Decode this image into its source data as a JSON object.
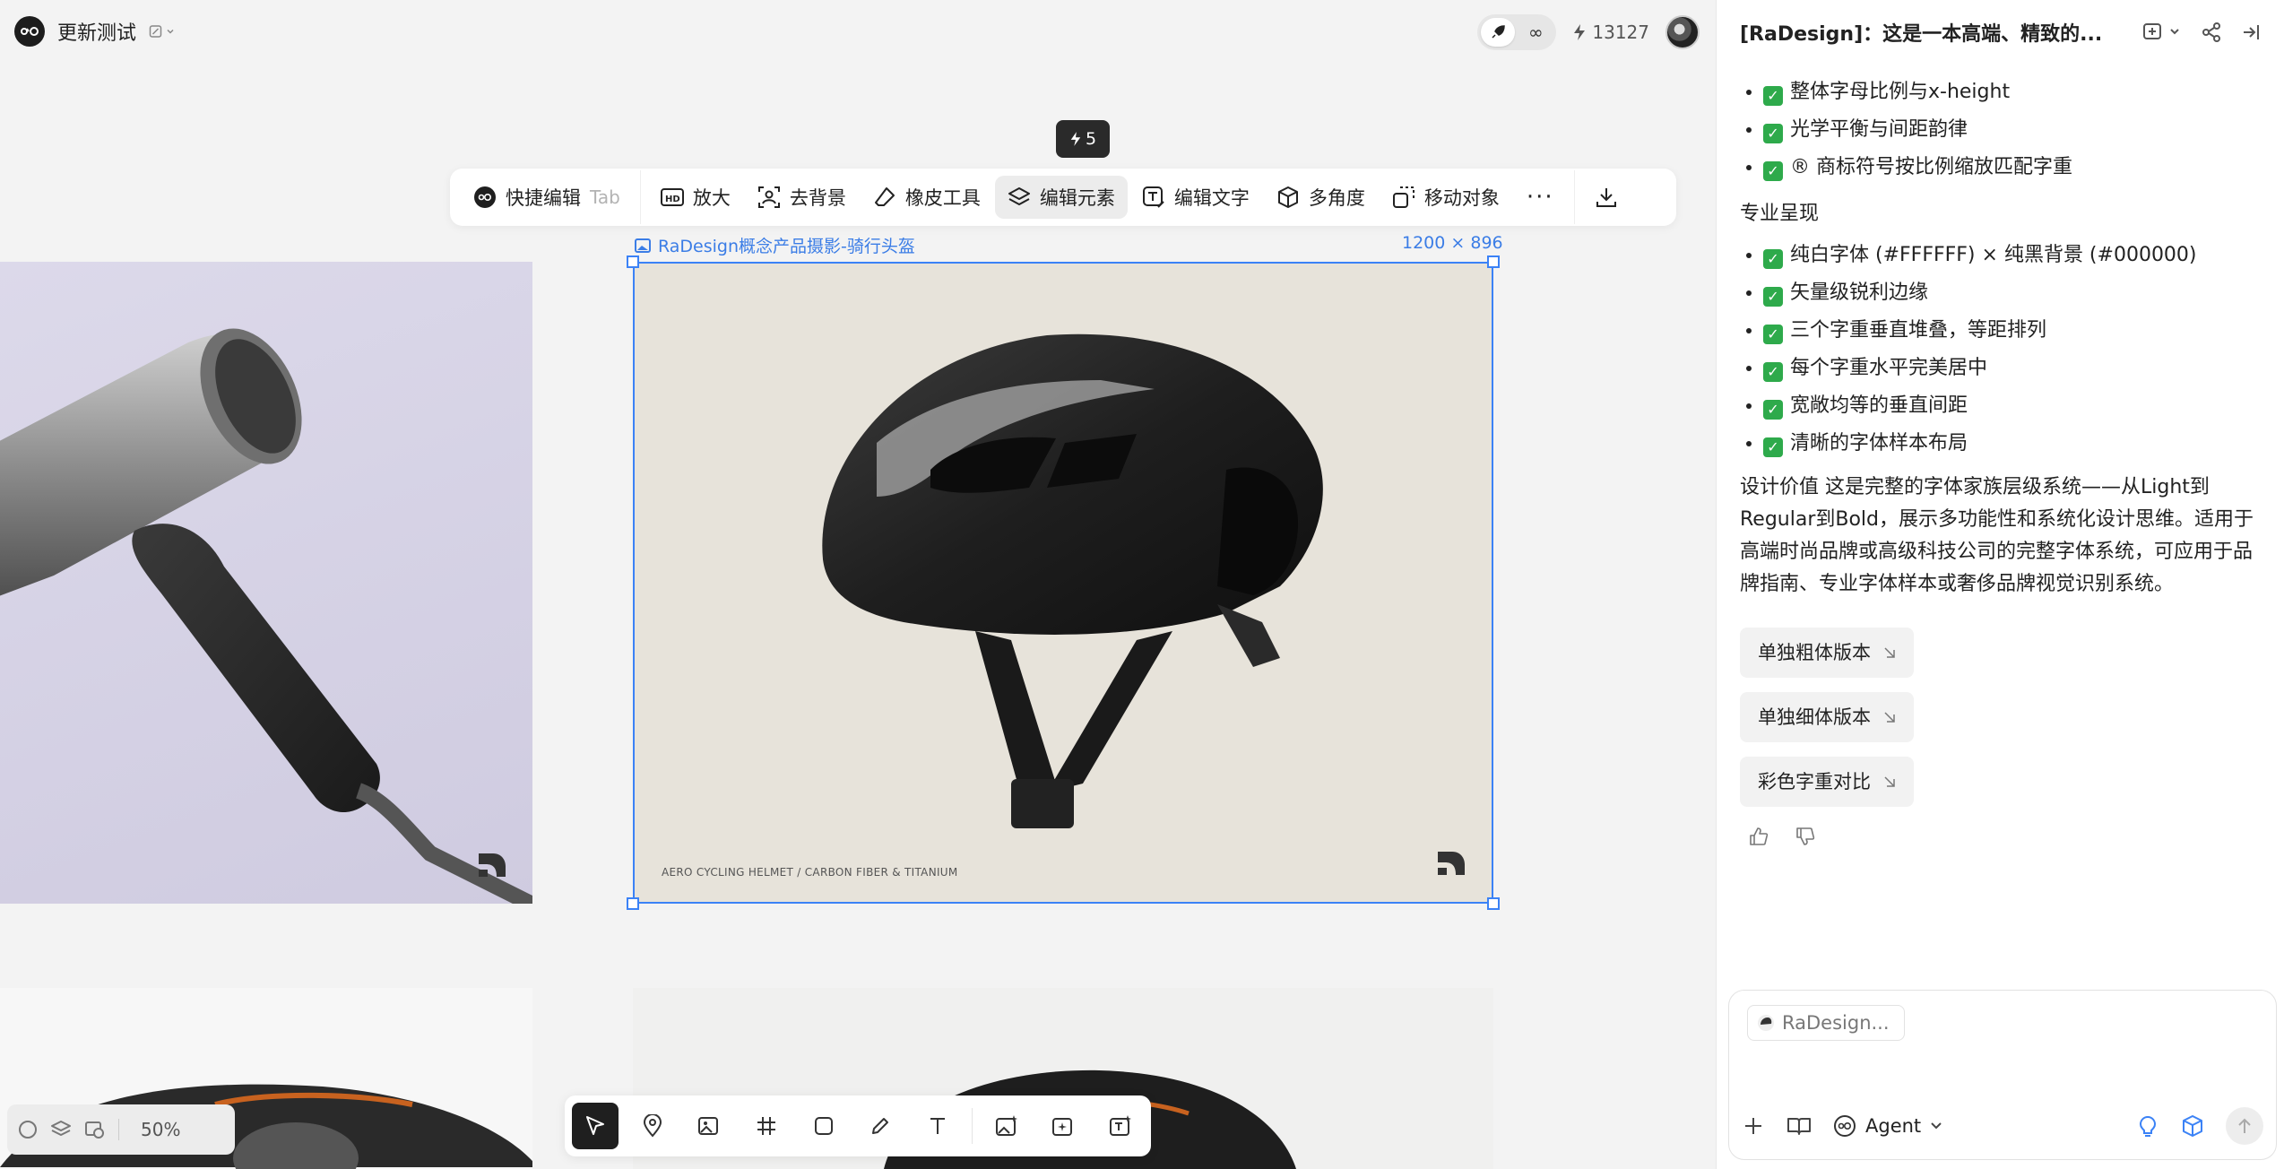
{
  "project": {
    "title": "更新测试"
  },
  "topbar": {
    "infinity": "∞",
    "credits": "13127"
  },
  "badge": {
    "count": "5"
  },
  "toolbar": {
    "quick_edit": "快捷编辑",
    "quick_edit_hint": "Tab",
    "upscale": "放大",
    "remove_bg": "去背景",
    "eraser": "橡皮工具",
    "edit_elements": "编辑元素",
    "edit_text": "编辑文字",
    "multi_angle": "多角度",
    "move_object": "移动对象",
    "more": "···"
  },
  "frame": {
    "label": "RaDesign概念产品摄影-骑行头盔",
    "size": "1200 × 896",
    "caption": "AERO CYCLING HELMET / CARBON FIBER & TITANIUM"
  },
  "zoom": {
    "value": "50%"
  },
  "panel": {
    "title": "[RaDesign]：这是一本高端、精致的...",
    "list1": [
      "整体字母比例与x-height",
      "光学平衡与间距韵律",
      "® 商标符号按比例缩放匹配字重"
    ],
    "section2_title": "专业呈现",
    "list2": [
      "纯白字体 (#FFFFFF) × 纯黑背景 (#000000)",
      "矢量级锐利边缘",
      "三个字重垂直堆叠，等距排列",
      "每个字重水平完美居中",
      "宽敞均等的垂直间距",
      "清晰的字体样本布局"
    ],
    "paragraph": "设计价值 这是完整的字体家族层级系统——从Light到Regular到Bold，展示多功能性和系统化设计思维。适用于高端时尚品牌或高级科技公司的完整字体系统，可应用于品牌指南、专业字体样本或奢侈品牌视觉识别系统。",
    "suggestions": [
      "单独粗体版本",
      "单独细体版本",
      "彩色字重对比"
    ]
  },
  "composer": {
    "chip": "RaDesign...",
    "agent": "Agent"
  },
  "colors": {
    "accent": "#3b82f6",
    "check": "#2eaa4b"
  }
}
